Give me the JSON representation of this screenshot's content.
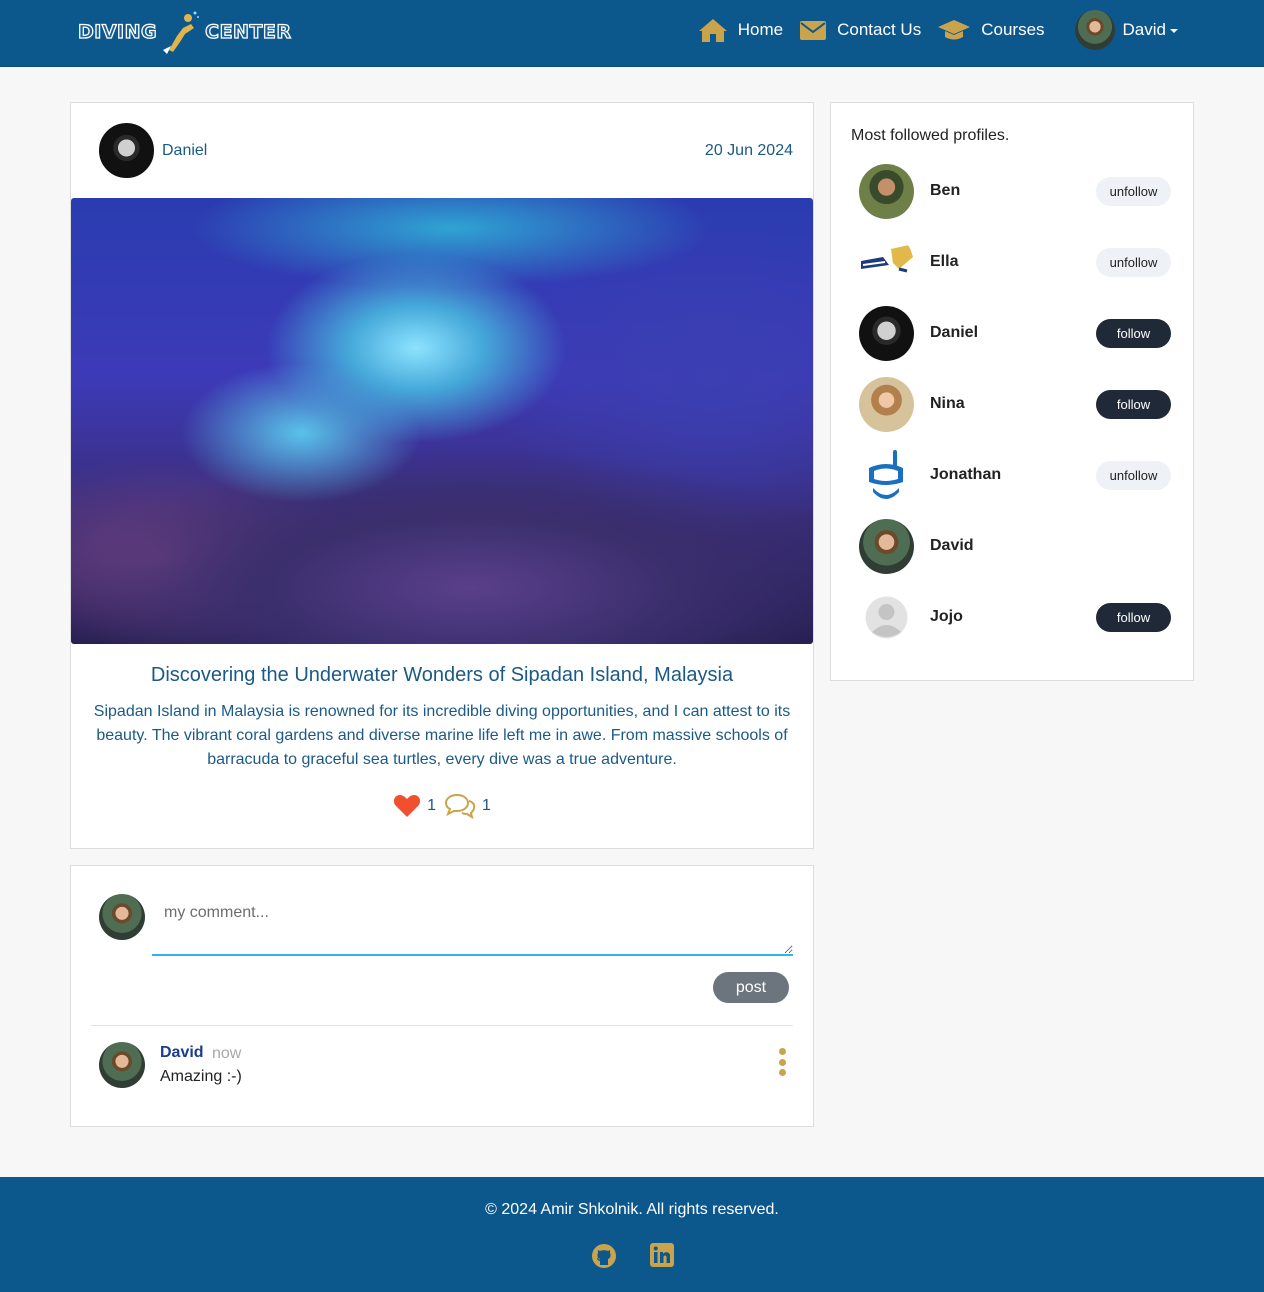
{
  "nav": {
    "brand_left": "DIVING",
    "brand_right": "CENTER",
    "items": [
      {
        "label": "Home",
        "icon": "home-icon"
      },
      {
        "label": "Contact Us",
        "icon": "envelope-icon"
      },
      {
        "label": "Courses",
        "icon": "graduation-cap-icon"
      }
    ],
    "user": "David"
  },
  "post": {
    "author": "Daniel",
    "date": "20 Jun 2024",
    "title": "Discovering the Underwater Wonders of Sipadan Island, Malaysia",
    "body": "Sipadan Island in Malaysia is renowned for its incredible diving opportunities, and I can attest to its beauty. The vibrant coral gardens and diverse marine life left me in awe. From massive schools of barracuda to graceful sea turtles, every dive was a true adventure.",
    "likes": "1",
    "comments_count": "1"
  },
  "comment_form": {
    "placeholder": "my comment...",
    "post_label": "post"
  },
  "comments": [
    {
      "user": "David",
      "time": "now",
      "text": "Amazing :-)"
    }
  ],
  "sidebar": {
    "title": "Most followed profiles.",
    "profiles": [
      {
        "name": "Ben",
        "action": "unfollow"
      },
      {
        "name": "Ella",
        "action": "unfollow"
      },
      {
        "name": "Daniel",
        "action": "follow"
      },
      {
        "name": "Nina",
        "action": "follow"
      },
      {
        "name": "Jonathan",
        "action": "unfollow"
      },
      {
        "name": "David",
        "action": ""
      },
      {
        "name": "Jojo",
        "action": "follow"
      }
    ]
  },
  "footer": {
    "copyright": "© 2024 Amir Shkolnik. All rights reserved.",
    "social": [
      "github-icon",
      "linkedin-icon"
    ]
  },
  "colors": {
    "navbar": "#0c578c",
    "accent_gold": "#c9a44c",
    "link_blue": "#1b5a86",
    "like_red": "#f0502d",
    "follow_dark": "#1f2937"
  }
}
